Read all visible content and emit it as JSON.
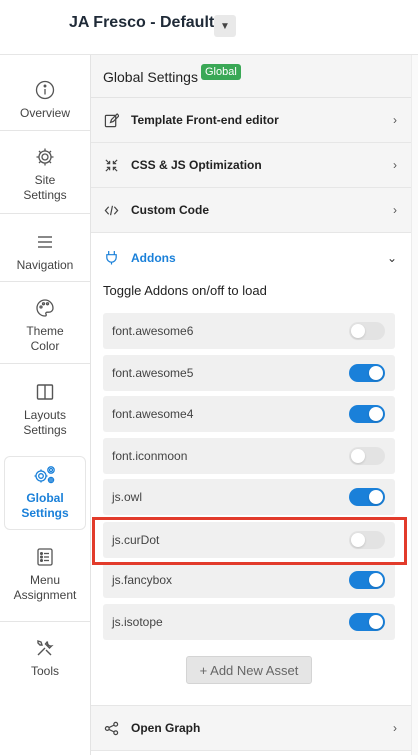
{
  "header": {
    "title": "JA Fresco - Default",
    "caret_icon": "chevron-down-icon"
  },
  "sidebar": {
    "items": [
      {
        "label": "Overview",
        "icon": "info-icon",
        "active": false
      },
      {
        "label": "Site\nSettings",
        "icon": "gear-icon",
        "active": false
      },
      {
        "label": "Navigation",
        "icon": "menu-icon",
        "active": false
      },
      {
        "label": "Theme\nColor",
        "icon": "palette-icon",
        "active": false
      },
      {
        "label": "Layouts\nSettings",
        "icon": "layout-icon",
        "active": false
      },
      {
        "label": "Global\nSettings",
        "icon": "gears-icon",
        "active": true
      },
      {
        "label": "Menu\nAssignment",
        "icon": "list-icon",
        "active": false
      },
      {
        "label": "Tools",
        "icon": "tools-icon",
        "active": false
      }
    ]
  },
  "main": {
    "title": "Global Settings",
    "badge": "Global",
    "sections": [
      {
        "label": "Template Front-end editor",
        "icon": "edit-icon",
        "open": false
      },
      {
        "label": "CSS & JS Optimization",
        "icon": "compress-icon",
        "open": false
      },
      {
        "label": "Custom Code",
        "icon": "code-icon",
        "open": false
      },
      {
        "label": "Addons",
        "icon": "plug-icon",
        "open": true
      }
    ],
    "addons_hint": "Toggle Addons on/off to load",
    "addons": [
      {
        "name": "font.awesome6",
        "enabled": false
      },
      {
        "name": "font.awesome5",
        "enabled": true
      },
      {
        "name": "font.awesome4",
        "enabled": true
      },
      {
        "name": "font.iconmoon",
        "enabled": false
      },
      {
        "name": "js.owl",
        "enabled": true
      },
      {
        "name": "js.curDot",
        "enabled": false
      },
      {
        "name": "js.fancybox",
        "enabled": true
      },
      {
        "name": "js.isotope",
        "enabled": true
      }
    ],
    "add_button": "+ Add New Asset",
    "footer_section": {
      "label": "Open Graph",
      "icon": "share-icon"
    }
  },
  "colors": {
    "accent": "#1a80d9",
    "badge": "#3aa856",
    "highlight": "#e23b2b"
  }
}
